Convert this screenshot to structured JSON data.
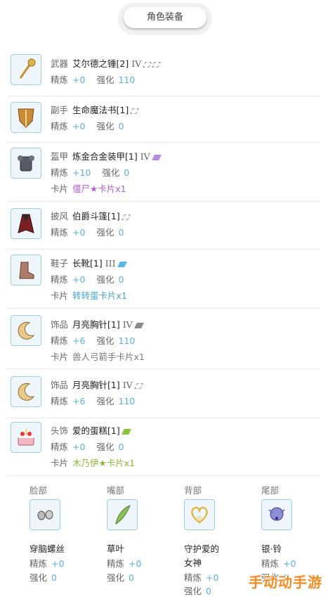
{
  "header": {
    "title": "角色装备"
  },
  "items": [
    {
      "slot": "武器",
      "name": "艾尔德之锤[2]",
      "tier": "IV",
      "refine_label": "精炼",
      "refine": "+0",
      "enhance_label": "强化",
      "enhance": "110",
      "card_label": "",
      "card": ""
    },
    {
      "slot": "副手",
      "name": "生命魔法书[1]",
      "tier": "",
      "refine_label": "精炼",
      "refine": "+0",
      "enhance_label": "强化",
      "enhance": "0",
      "card_label": "",
      "card": ""
    },
    {
      "slot": "盔甲",
      "name": "炼金合金装甲[1]",
      "tier": "IV",
      "refine_label": "精炼",
      "refine": "+10",
      "enhance_label": "强化",
      "enhance": "0",
      "card_label": "卡片",
      "card": "僵尸★卡片x1"
    },
    {
      "slot": "披风",
      "name": "伯爵斗篷[1]",
      "tier": "",
      "refine_label": "精炼",
      "refine": "+0",
      "enhance_label": "强化",
      "enhance": "0",
      "card_label": "",
      "card": ""
    },
    {
      "slot": "鞋子",
      "name": "长靴[1]",
      "tier": "III",
      "refine_label": "精炼",
      "refine": "+0",
      "enhance_label": "强化",
      "enhance": "0",
      "card_label": "卡片",
      "card": "转转蛋卡片x1"
    },
    {
      "slot": "饰品",
      "name": "月亮胸针[1]",
      "tier": "IV",
      "refine_label": "精炼",
      "refine": "+6",
      "enhance_label": "强化",
      "enhance": "110",
      "card_label": "卡片",
      "card": "兽人弓箭手卡片x1"
    },
    {
      "slot": "饰品",
      "name": "月亮胸针[1]",
      "tier": "IV",
      "refine_label": "精炼",
      "refine": "+6",
      "enhance_label": "强化",
      "enhance": "110",
      "card_label": "",
      "card": ""
    },
    {
      "slot": "头饰",
      "name": "爱的蛋糕[1]",
      "tier": "",
      "refine_label": "精炼",
      "refine": "+0",
      "enhance_label": "强化",
      "enhance": "0",
      "card_label": "卡片",
      "card": "木乃伊★卡片x1"
    }
  ],
  "accessories": [
    {
      "slot": "脸部",
      "name": "穿脑螺丝",
      "refine_label": "精炼",
      "refine": "+0",
      "enhance_label": "强化",
      "enhance": "0"
    },
    {
      "slot": "嘴部",
      "name": "草叶",
      "refine_label": "精炼",
      "refine": "+0",
      "enhance_label": "强化",
      "enhance": "0"
    },
    {
      "slot": "背部",
      "name": "守护爱的女神",
      "name_line1": "守护爱的",
      "name_line2": "女神",
      "refine_label": "精炼",
      "refine": "+0",
      "enhance_label": "强化",
      "enhance": "0"
    },
    {
      "slot": "尾部",
      "name": "银·铃",
      "refine_label": "精炼",
      "refine": "+0",
      "enhance_label": "强化",
      "enhance": "0"
    }
  ],
  "watermark": "手动动手游",
  "colors": {
    "value_blue": "#5aaee0",
    "card_pink": "#b45fd1",
    "card_blue": "#45a6d6",
    "card_green": "#8cb931",
    "icon_border": "#9ccfe6"
  }
}
